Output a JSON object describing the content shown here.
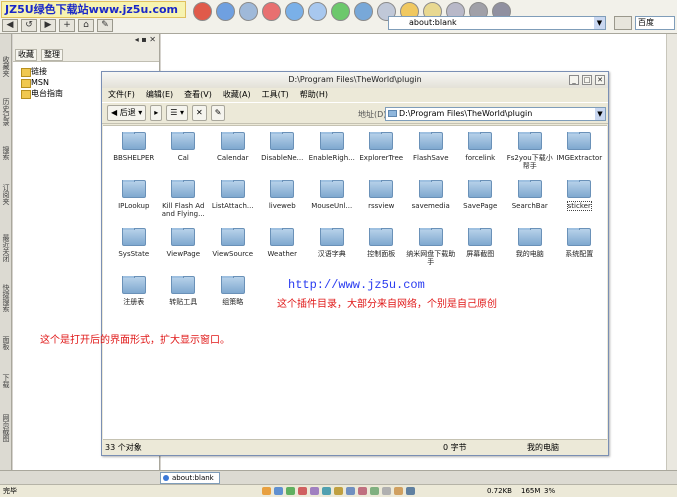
{
  "browser": {
    "brand": "JZ5U绿色下载站www.jz5u.com",
    "address": "about:blank",
    "search_engine": "百度"
  },
  "vertical_tabs": [
    "收藏夹",
    "历史记录",
    "搜索",
    "订阅夹",
    "最近关闭",
    "快捷搜索",
    "面板",
    "下载",
    "网页截图"
  ],
  "sidebar": {
    "tabs": [
      "收藏",
      "整理"
    ],
    "items": [
      "链接",
      "MSN",
      "电台指南"
    ]
  },
  "explorer": {
    "title": "D:\\Program Files\\TheWorld\\plugin",
    "menu": [
      "文件(F)",
      "编辑(E)",
      "查看(V)",
      "收藏(A)",
      "工具(T)",
      "帮助(H)"
    ],
    "toolbar": {
      "back": "后退"
    },
    "address_label": "地址(D)",
    "address": "D:\\Program Files\\TheWorld\\plugin",
    "folders": [
      "BBSHELPER",
      "Cal",
      "Calendar",
      "DisableNe...",
      "EnableRigh...",
      "ExplorerTree",
      "FlashSave",
      "forcelink",
      "Fs2you下载小帮手",
      "IMGExtractor",
      "IPLookup",
      "Kill Flash Ad and Flying...",
      "ListAttach...",
      "liveweb",
      "MouseUnl...",
      "rssview",
      "savemedia",
      "SavePage",
      "SearchBar",
      "sticker",
      "SysState",
      "ViewPage",
      "ViewSource",
      "Weather",
      "汉语字典",
      "控制面板",
      "纳米网盘下载助手",
      "屏幕截图",
      "我的电脑",
      "系统配置",
      "注册表",
      "转贴工具",
      "组策略"
    ],
    "selected": "sticker",
    "status": {
      "count": "33 个对象",
      "size": "0 字节",
      "location": "我的电脑"
    }
  },
  "overlay": {
    "url": "http://www.jz5u.com",
    "note_plugin": "这个插件目录，大部分来自网络，个别是自己原创",
    "note_window": "这个是打开后的界面形式，扩大显示窗口。"
  },
  "tabs": {
    "active": "about:blank"
  },
  "statusbar": {
    "left": "完毕",
    "speed": "0.72KB",
    "memory": "165M",
    "cpu": "3%"
  },
  "colors": {
    "brand_text": "#1a28c8",
    "note": "#e01818",
    "url_overlay": "#2a3cf0",
    "folder": "#7fa8cf"
  }
}
